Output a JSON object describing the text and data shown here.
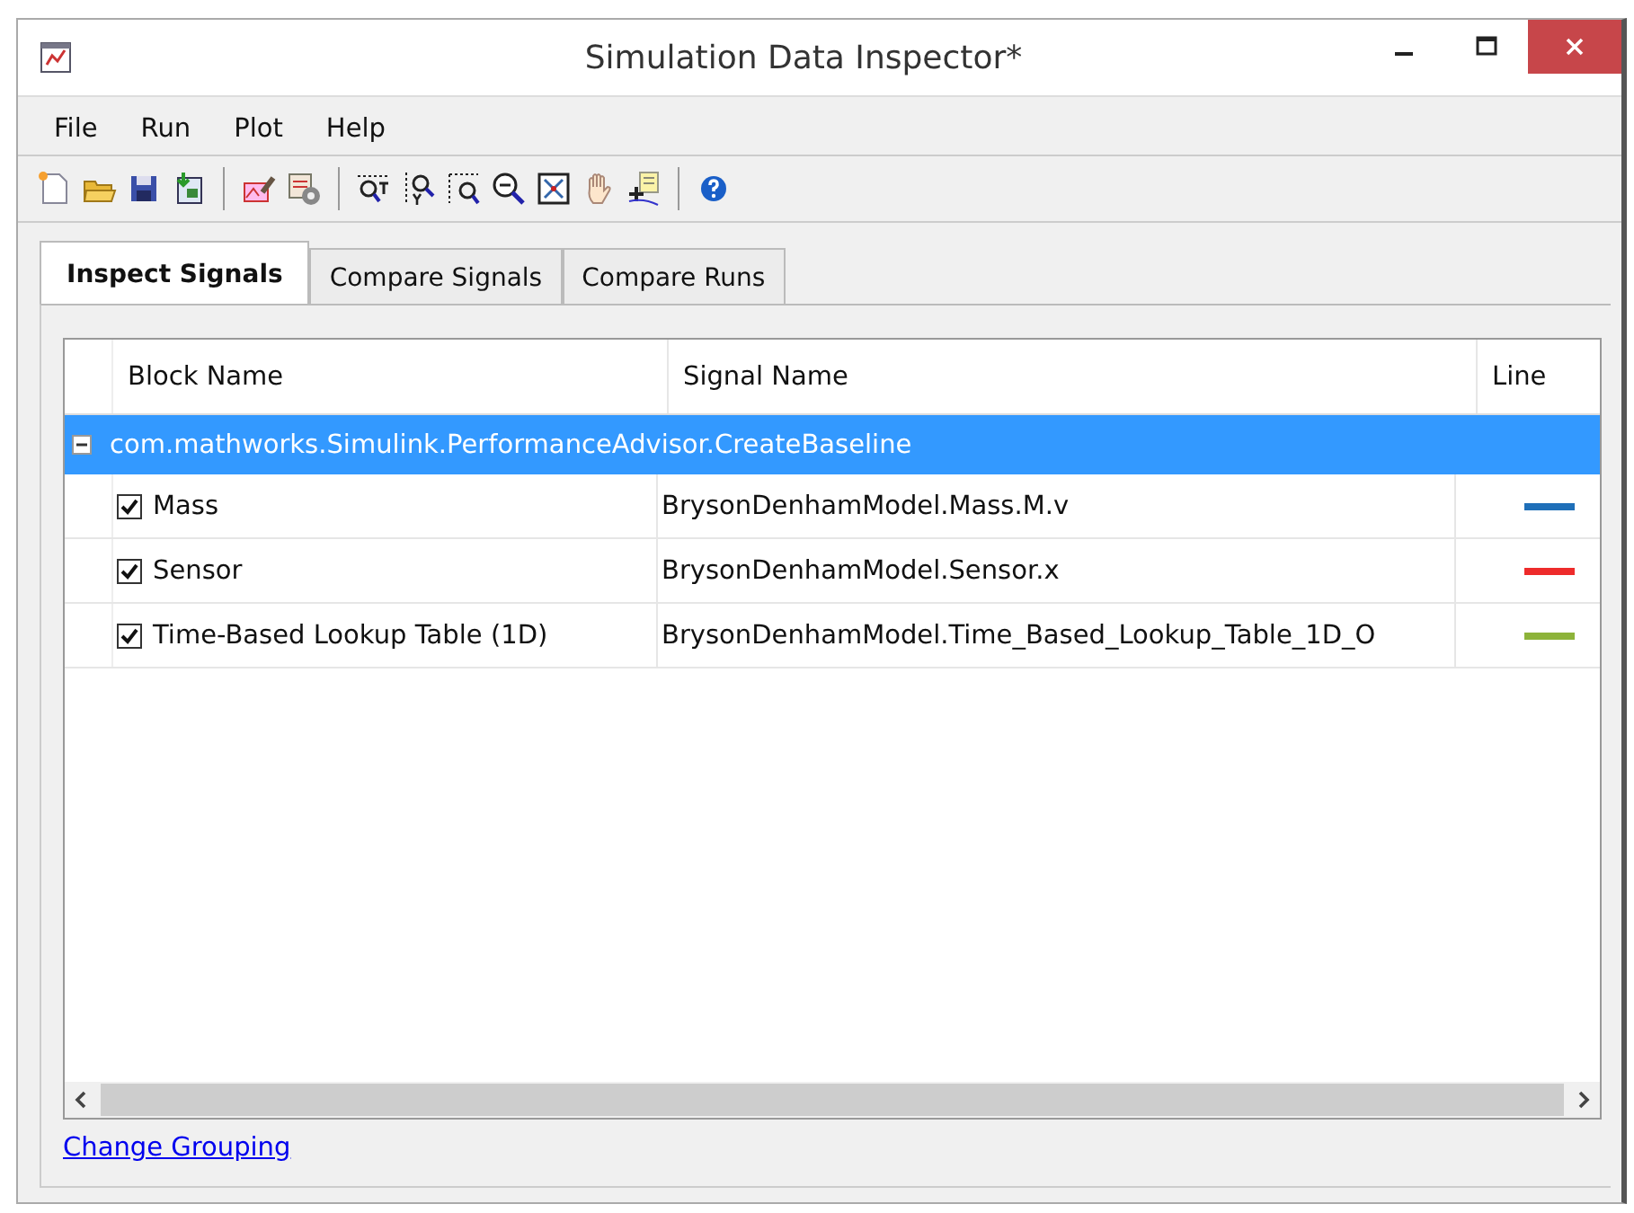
{
  "window": {
    "title": "Simulation Data Inspector*"
  },
  "menu": [
    "File",
    "Run",
    "Plot",
    "Help"
  ],
  "tabs": [
    {
      "label": "Inspect Signals",
      "selected": true
    },
    {
      "label": "Compare Signals",
      "selected": false
    },
    {
      "label": "Compare Runs",
      "selected": false
    }
  ],
  "table": {
    "columns": [
      "Block Name",
      "Signal Name",
      "Line"
    ],
    "group": {
      "label": "com.mathworks.Simulink.PerformanceAdvisor.CreateBaseline",
      "expanded": true,
      "selected": true
    },
    "rows": [
      {
        "block": "Mass",
        "signal": "BrysonDenhamModel.Mass.M.v",
        "checked": true,
        "color": "#1f6fb8"
      },
      {
        "block": "Sensor",
        "signal": "BrysonDenhamModel.Sensor.x",
        "checked": true,
        "color": "#ee2b2b"
      },
      {
        "block": "Time-Based Lookup Table (1D)",
        "signal": "BrysonDenhamModel.Time_Based_Lookup_Table_1D_O",
        "checked": true,
        "color": "#8db33a"
      }
    ]
  },
  "link": "Change Grouping"
}
